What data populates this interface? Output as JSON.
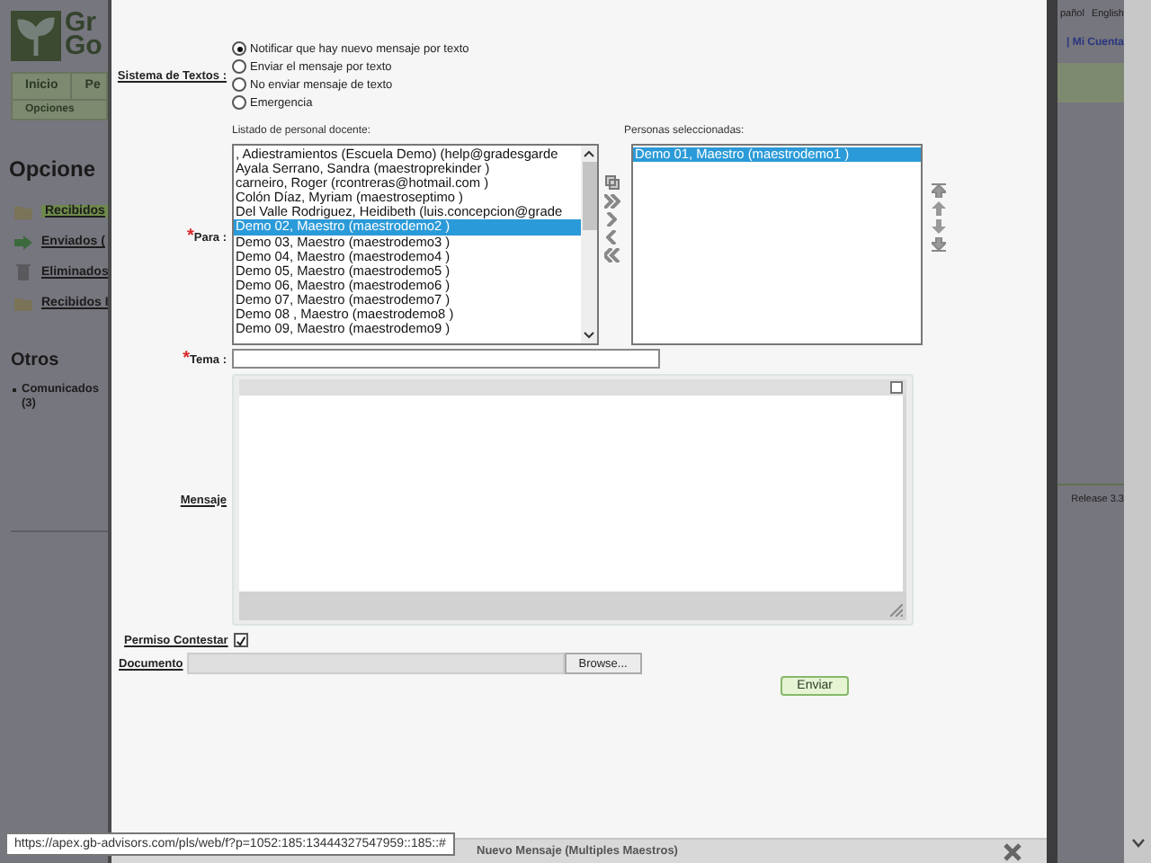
{
  "background": {
    "logo_lines": [
      "Gr",
      "Go"
    ],
    "tabs": [
      {
        "label": "Inicio",
        "selected": false
      },
      {
        "label": "Pe",
        "selected": false
      }
    ],
    "subtab": "Opciones",
    "heading": "Opcione",
    "sidebar": {
      "items": [
        {
          "label": "Recibidos",
          "kind": "inbox",
          "selected": true
        },
        {
          "label": "Enviados (",
          "kind": "sent",
          "selected": false
        },
        {
          "label": "Eliminados",
          "kind": "trash",
          "selected": false
        },
        {
          "label": "Recibidos I",
          "kind": "inbox",
          "selected": false
        }
      ]
    },
    "otros": {
      "heading": "Otros",
      "items": [
        "Comunicados (3)"
      ]
    },
    "languages": [
      "pañol",
      "English"
    ],
    "account": "| Mi Cuenta",
    "release": "Release 3.3"
  },
  "dialog": {
    "title": "Nuevo Mensaje (Multiples Maestros)",
    "sms": {
      "label": "Sistema de Textos :",
      "options": [
        {
          "label": "Notificar que hay nuevo mensaje por texto",
          "selected": true
        },
        {
          "label": "Enviar el mensaje por texto",
          "selected": false
        },
        {
          "label": "No enviar mensaje de texto",
          "selected": false
        },
        {
          "label": "Emergencia",
          "selected": false
        }
      ]
    },
    "para": {
      "label": "Para :",
      "required_mark": "*",
      "available_label": "Listado de personal docente:",
      "selected_label": "Personas seleccionadas:",
      "available": [
        {
          "label": ", Adiestramientos (Escuela Demo) (help@gradesgarde",
          "selected": false
        },
        {
          "label": "Ayala Serrano, Sandra (maestroprekinder )",
          "selected": false
        },
        {
          "label": "carneiro, Roger (rcontreras@hotmail.com )",
          "selected": false
        },
        {
          "label": "Colón Díaz, Myriam (maestroseptimo )",
          "selected": false
        },
        {
          "label": "Del Valle Rodriguez, Heidibeth (luis.concepcion@grade",
          "selected": false
        },
        {
          "label": "Demo 02, Maestro (maestrodemo2 )",
          "selected": true
        },
        {
          "label": "Demo 03, Maestro (maestrodemo3 )",
          "selected": false
        },
        {
          "label": "Demo 04, Maestro (maestrodemo4 )",
          "selected": false
        },
        {
          "label": "Demo 05, Maestro (maestrodemo5 )",
          "selected": false
        },
        {
          "label": "Demo 06, Maestro (maestrodemo6 )",
          "selected": false
        },
        {
          "label": "Demo 07, Maestro (maestrodemo7 )",
          "selected": false
        },
        {
          "label": "Demo 08 , Maestro (maestrodemo8 )",
          "selected": false
        },
        {
          "label": "Demo 09, Maestro (maestrodemo9 )",
          "selected": false
        }
      ],
      "chosen": [
        {
          "label": "Demo 01, Maestro (maestrodemo1 )",
          "selected": true
        }
      ]
    },
    "tema": {
      "label": "Tema :",
      "required_mark": "*"
    },
    "mensaje": {
      "label": "Mensaje"
    },
    "permiso": {
      "label": "Permiso Contestar",
      "checked": true
    },
    "documento": {
      "label": "Documento",
      "button": "Browse..."
    },
    "send_button": "Enviar"
  },
  "tooltip": "https://apex.gb-advisors.com/pls/web/f?p=1052:185:13444327547959::185::#"
}
